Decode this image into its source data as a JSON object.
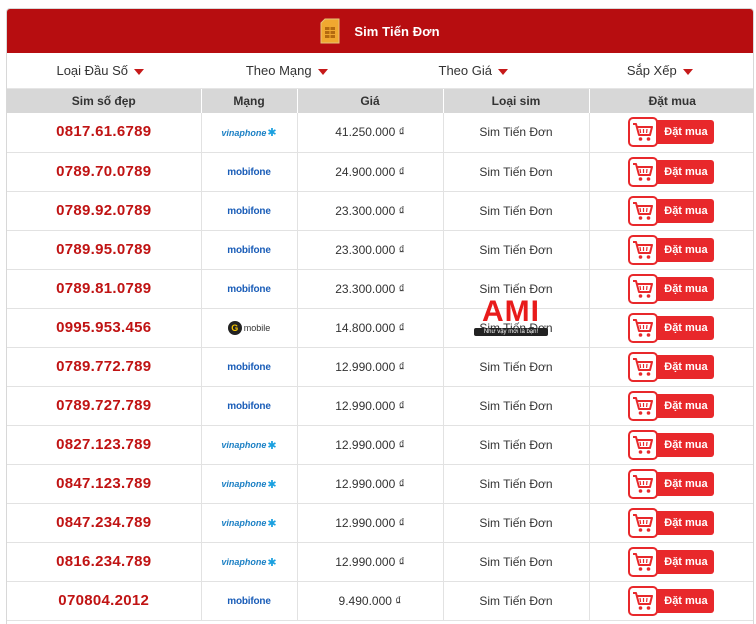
{
  "header": {
    "title": "Sim Tiến Đơn",
    "icon": "sim-card-icon"
  },
  "filters": [
    {
      "label": "Loại Đầu Số"
    },
    {
      "label": "Theo Mạng"
    },
    {
      "label": "Theo Giá"
    },
    {
      "label": "Sắp Xếp"
    }
  ],
  "table": {
    "columns": [
      "Sim số đẹp",
      "Mạng",
      "Giá",
      "Loại sim",
      "Đặt mua"
    ],
    "rows": [
      {
        "number": "0817.61.6789",
        "network": "vinaphone",
        "price": "41.250.000 ₫",
        "type": "Sim Tiến Đơn",
        "buy": "Đặt mua"
      },
      {
        "number": "0789.70.0789",
        "network": "mobifone",
        "price": "24.900.000 ₫",
        "type": "Sim Tiến Đơn",
        "buy": "Đặt mua"
      },
      {
        "number": "0789.92.0789",
        "network": "mobifone",
        "price": "23.300.000 ₫",
        "type": "Sim Tiến Đơn",
        "buy": "Đặt mua"
      },
      {
        "number": "0789.95.0789",
        "network": "mobifone",
        "price": "23.300.000 ₫",
        "type": "Sim Tiến Đơn",
        "buy": "Đặt mua"
      },
      {
        "number": "0789.81.0789",
        "network": "mobifone",
        "price": "23.300.000 ₫",
        "type": "Sim Tiến Đơn",
        "buy": "Đặt mua"
      },
      {
        "number": "0995.953.456",
        "network": "gmobile",
        "price": "14.800.000 ₫",
        "type": "Sim Tiến Đơn",
        "buy": "Đặt mua"
      },
      {
        "number": "0789.772.789",
        "network": "mobifone",
        "price": "12.990.000 ₫",
        "type": "Sim Tiến Đơn",
        "buy": "Đặt mua"
      },
      {
        "number": "0789.727.789",
        "network": "mobifone",
        "price": "12.990.000 ₫",
        "type": "Sim Tiến Đơn",
        "buy": "Đặt mua"
      },
      {
        "number": "0827.123.789",
        "network": "vinaphone",
        "price": "12.990.000 ₫",
        "type": "Sim Tiến Đơn",
        "buy": "Đặt mua"
      },
      {
        "number": "0847.123.789",
        "network": "vinaphone",
        "price": "12.990.000 ₫",
        "type": "Sim Tiến Đơn",
        "buy": "Đặt mua"
      },
      {
        "number": "0847.234.789",
        "network": "vinaphone",
        "price": "12.990.000 ₫",
        "type": "Sim Tiến Đơn",
        "buy": "Đặt mua"
      },
      {
        "number": "0816.234.789",
        "network": "vinaphone",
        "price": "12.990.000 ₫",
        "type": "Sim Tiến Đơn",
        "buy": "Đặt mua"
      },
      {
        "number": "070804.2012",
        "network": "mobifone",
        "price": "9.490.000 ₫",
        "type": "Sim Tiến Đơn",
        "buy": "Đặt mua"
      }
    ]
  },
  "logos": {
    "vinaphone": "vinaphone",
    "mobifone": "mobifone",
    "gmobile": "mobile"
  },
  "watermark": {
    "brand": "AMI",
    "slogan": "Như vậy mới là bạn!"
  },
  "colors": {
    "brand_red": "#b70d10",
    "number_red": "#c01313",
    "button_red": "#e8282b",
    "header_gray": "#d7d7d7"
  }
}
